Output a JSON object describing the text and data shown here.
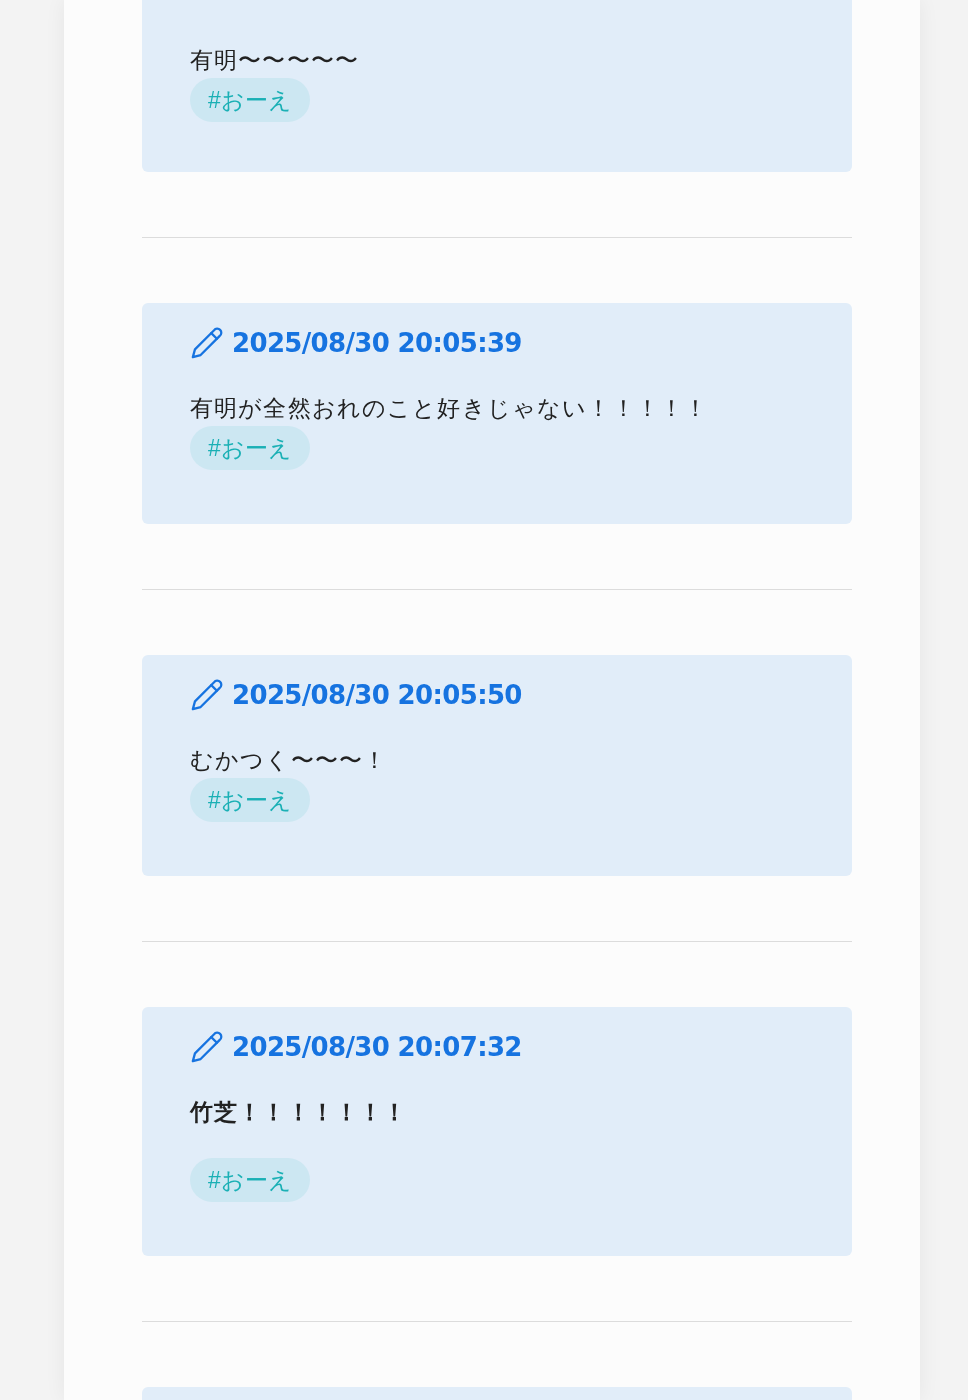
{
  "posts": [
    {
      "body": "有明〜〜〜〜〜",
      "body_bold": false,
      "tags": [
        "#おーえ"
      ]
    },
    {
      "timestamp": "2025/08/30 20:05:39",
      "body": "有明が全然おれのこと好きじゃない！！！！！",
      "body_bold": false,
      "tags": [
        "#おーえ"
      ]
    },
    {
      "timestamp": "2025/08/30 20:05:50",
      "body": "むかつく〜〜〜！",
      "body_bold": false,
      "tags": [
        "#おーえ"
      ]
    },
    {
      "timestamp": "2025/08/30 20:07:32",
      "body": "竹芝！！！！！！！",
      "body_bold": true,
      "tags": [
        "#おーえ"
      ]
    },
    {
      "kind": "cut_off"
    }
  ]
}
